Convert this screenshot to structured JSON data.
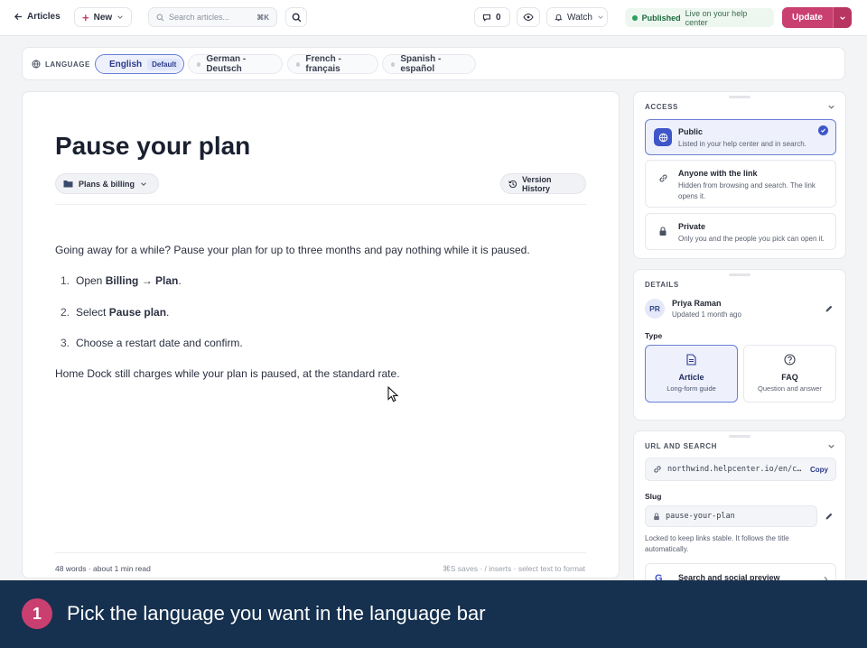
{
  "topbar": {
    "back_label": "Articles",
    "new_label": "New",
    "search_placeholder": "Search articles...",
    "search_shortcut": "⌘K",
    "comments_count": "0",
    "watch_label": "Watch",
    "status_label": "Published",
    "status_detail": "Live on your help center",
    "update_label": "Update"
  },
  "language_bar": {
    "label": "LANGUAGE",
    "languages": [
      {
        "name": "English",
        "badge": "Default"
      },
      {
        "name": "German - Deutsch"
      },
      {
        "name": "French - français"
      },
      {
        "name": "Spanish - español"
      }
    ]
  },
  "article": {
    "title": "Pause your plan",
    "category": "Plans & billing",
    "version_history_label": "Version History",
    "intro": "Going away for a while? Pause your plan for up to three months and pay nothing while it is paused.",
    "steps": [
      {
        "num": "1.",
        "prefix": "Open ",
        "bold": "Billing → Plan",
        "suffix": "."
      },
      {
        "num": "2.",
        "prefix": "Select ",
        "bold": "Pause plan",
        "suffix": "."
      },
      {
        "num": "3.",
        "prefix": "Choose a restart date and confirm.",
        "bold": "",
        "suffix": ""
      }
    ],
    "note": "Home Dock still charges while your plan is paused, at the standard rate.",
    "word_count": "48 words · about 1 min read",
    "hint": "⌘S saves · / inserts · select text to format"
  },
  "access": {
    "title": "ACCESS",
    "options": [
      {
        "title": "Public",
        "desc": "Listed in your help center and in search."
      },
      {
        "title": "Anyone with the link",
        "desc": "Hidden from browsing and search. The link opens it."
      },
      {
        "title": "Private",
        "desc": "Only you and the people you pick can open it."
      }
    ]
  },
  "details": {
    "title": "DETAILS",
    "author_initials": "PR",
    "author_name": "Priya Raman",
    "updated": "Updated 1 month ago",
    "type_label": "Type",
    "types": [
      {
        "title": "Article",
        "desc": "Long-form guide"
      },
      {
        "title": "FAQ",
        "desc": "Question and answer"
      }
    ]
  },
  "url_search": {
    "title": "URL AND SEARCH",
    "url": "northwind.helpcenter.io/en/c…",
    "copy_label": "Copy",
    "slug_label": "Slug",
    "slug_value": "pause-your-plan",
    "slug_note": "Locked to keep links stable. It follows the title automatically.",
    "preview_label": "Search and social preview"
  },
  "tutorial": {
    "step_number": "1",
    "step_text": "Pick the language you want in the language bar"
  },
  "colors": {
    "accent": "#c93f6f",
    "brand_blue": "#4a63d0",
    "footer_bg": "#16314f",
    "published_green": "#2e9e5b"
  }
}
